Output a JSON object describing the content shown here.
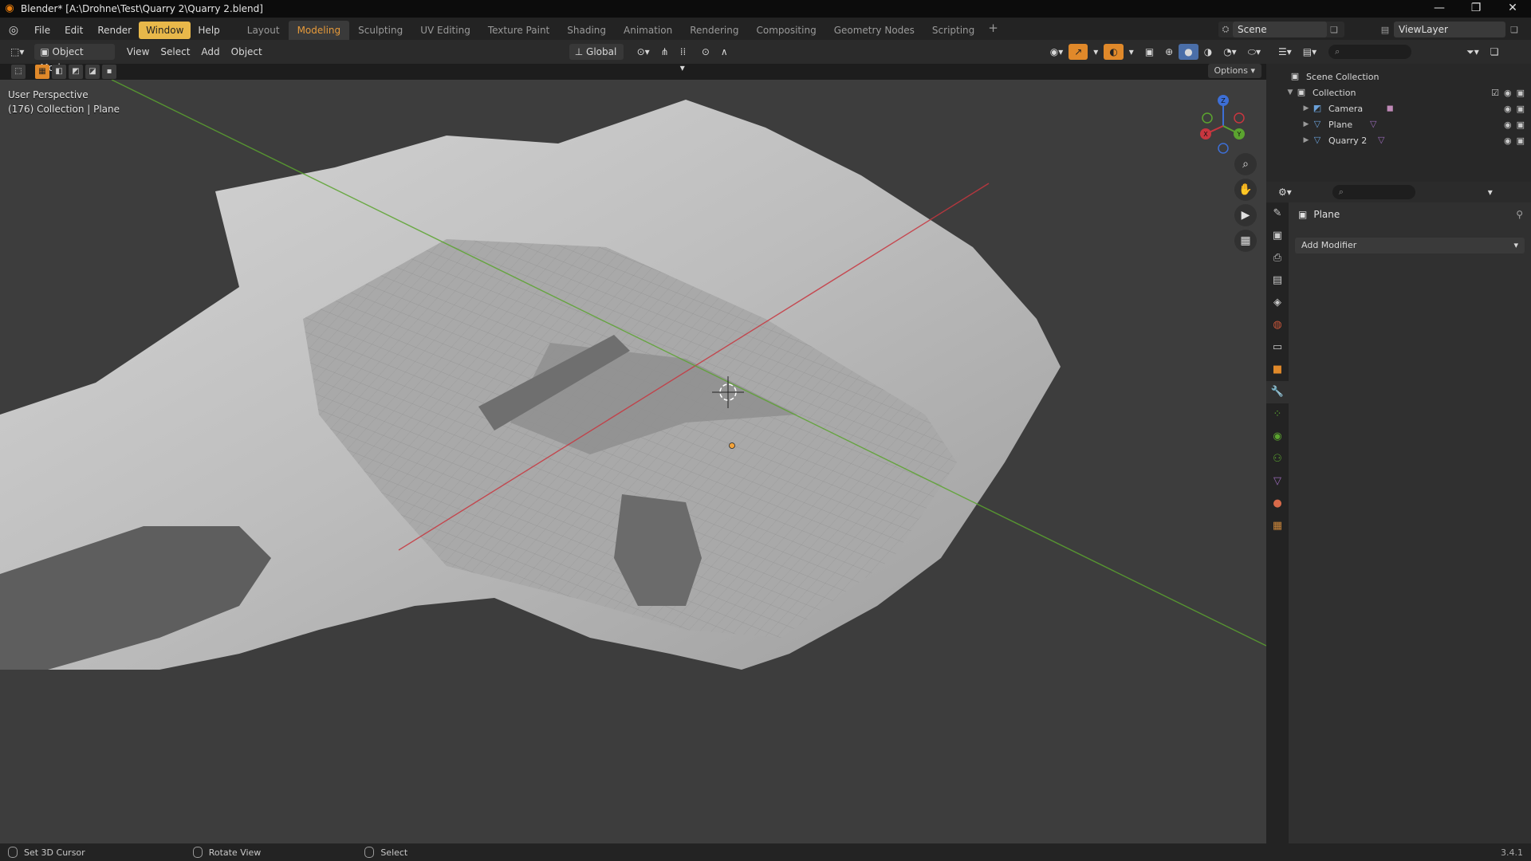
{
  "window": {
    "title": "Blender* [A:\\Drohne\\Test\\Quarry 2\\Quarry 2.blend]",
    "controls": [
      "—",
      "❐",
      "✕"
    ]
  },
  "menubar": {
    "menus": [
      "File",
      "Edit",
      "Render",
      "Window",
      "Help"
    ],
    "active_menu": "Window",
    "workspaces": [
      "Layout",
      "Modeling",
      "Sculpting",
      "UV Editing",
      "Texture Paint",
      "Shading",
      "Animation",
      "Rendering",
      "Compositing",
      "Geometry Nodes",
      "Scripting"
    ],
    "active_workspace": "Modeling",
    "add_tab": "+",
    "scene": "Scene",
    "view_layer": "ViewLayer"
  },
  "viewport_header": {
    "mode": "Object Mode",
    "menus": [
      "View",
      "Select",
      "Add",
      "Object"
    ],
    "orientation": "Global",
    "options": "Options"
  },
  "viewport": {
    "perspective": "User Perspective",
    "collection_info": "(176) Collection | Plane",
    "gizmo_axes": {
      "x": "X",
      "y": "Y",
      "z": "Z"
    },
    "colors": {
      "x_axis": "#c8363f",
      "y_axis": "#5ba42f",
      "z_axis": "#3d6fd6",
      "background": "#3d3d3d",
      "accent": "#e0892a"
    }
  },
  "outliner": {
    "root": "Scene Collection",
    "collection": "Collection",
    "objects": [
      "Camera",
      "Plane",
      "Quarry 2"
    ]
  },
  "properties": {
    "object_name": "Plane",
    "add_modifier": "Add Modifier"
  },
  "statusbar": {
    "items": [
      "Set 3D Cursor",
      "Rotate View",
      "Select"
    ],
    "version": "3.4.1"
  }
}
